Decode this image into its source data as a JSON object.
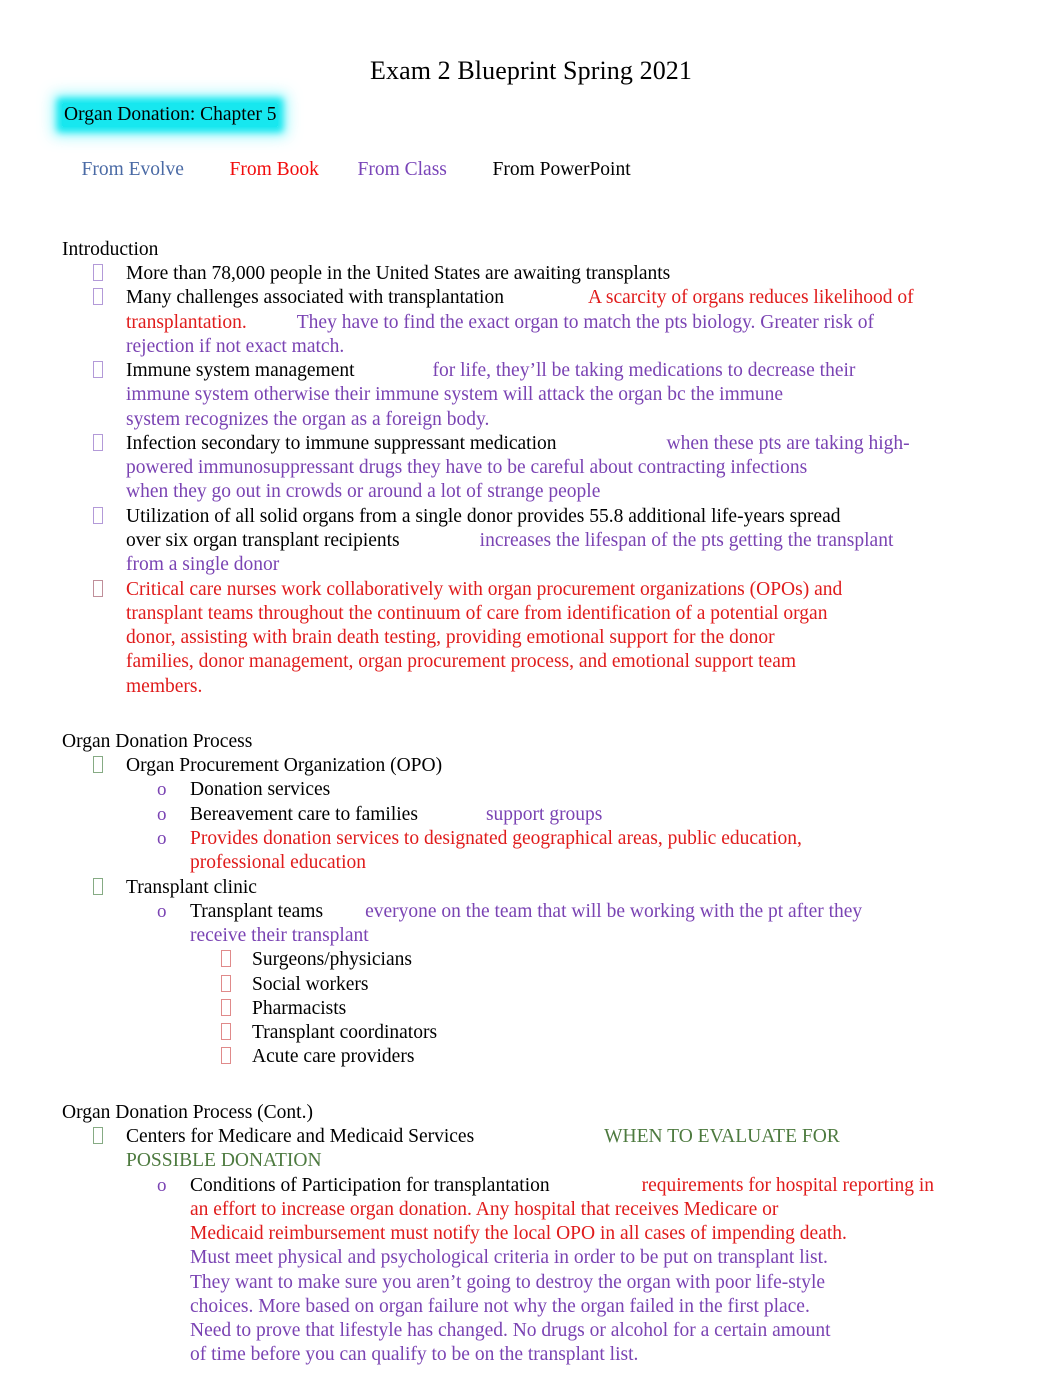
{
  "document": {
    "title": "Exam 2 Blueprint Spring 2021",
    "chapter_heading": "Organ Donation: Chapter 5",
    "highlight_color": "#17e7ef"
  },
  "legend": {
    "evolve": "From Evolve",
    "book": "From Book",
    "class": "From Class",
    "powerpoint": "From PowerPoint",
    "colors": {
      "evolve": "#4a6aa5",
      "book": "#f10c0c",
      "class": "#7944b8",
      "powerpoint": "#000000"
    }
  },
  "sections": {
    "introduction": {
      "heading": "Introduction",
      "b1": "More than 78,000 people in the United States are awaiting transplants",
      "b2_black": "Many challenges associated with transplantation",
      "b2_red_a": "A scarcity of organs reduces likelihood of",
      "b2_red_b": "transplantation.",
      "b2_purple_a": "They have to find the exact organ to match the pts biology. Greater risk of",
      "b2_purple_b": "rejection if not exact match.",
      "b3_black": "Immune system management",
      "b3_purple_a": "for life, they’ll be taking medications to decrease their",
      "b3_purple_b": "immune system otherwise their immune system will attack the organ bc the immune",
      "b3_purple_c": "system recognizes the organ as a foreign body.",
      "b4_black": "Infection secondary to immune suppressant medication",
      "b4_purple_a": "when these pts are taking high-",
      "b4_purple_b": "powered immunosuppressant drugs they have to be careful about contracting infections",
      "b4_purple_c": "when they go out in crowds or around a lot of strange people",
      "b5_black_a": "Utilization of all solid organs from a single donor provides 55.8 additional life-years spread",
      "b5_black_b": "over six organ transplant recipients",
      "b5_purple_a": "increases the lifespan of the pts getting the transplant",
      "b5_purple_b": "from a single donor",
      "b6_red_a": "Critical care nurses work collaboratively with organ procurement organizations (OPOs) and",
      "b6_red_b": "transplant teams throughout the continuum of care from identification of a potential organ",
      "b6_red_c": "donor, assisting with brain death testing, providing emotional support for the donor",
      "b6_red_d": "families, donor management, organ procurement process, and emotional support team",
      "b6_red_e": "members."
    },
    "process": {
      "heading": "Organ Donation Process",
      "opo": "Organ Procurement Organization (OPO)",
      "opo_sub1": "Donation services",
      "opo_sub2_black": "Bereavement care to families",
      "opo_sub2_purple": "support groups",
      "opo_sub3_red_a": "Provides donation services to designated geographical areas, public education,",
      "opo_sub3_red_b": "professional education",
      "clinic": "Transplant clinic",
      "clinic_sub_black": "Transplant teams",
      "clinic_sub_purple_a": "everyone on the team that will be working with the pt after they",
      "clinic_sub_purple_b": "receive their transplant",
      "team": [
        "Surgeons/physicians",
        "Social workers",
        "Pharmacists",
        "Transplant coordinators",
        "Acute care providers"
      ]
    },
    "process_cont": {
      "heading": "Organ Donation Process (Cont.)",
      "cms_black": "Centers for Medicare and Medicaid Services",
      "cms_green_a": "WHEN TO EVALUATE FOR",
      "cms_green_b": "POSSIBLE DONATION",
      "cop_black": "Conditions of Participation for transplantation",
      "cop_red_a": "requirements for hospital reporting in",
      "cop_red_b": "an effort to increase organ donation. Any hospital that receives Medicare or",
      "cop_red_c": "Medicaid reimbursement must notify the local OPO in all cases of impending death.",
      "cop_purple_a": "Must meet physical and psychological criteria in order to be put on transplant list.",
      "cop_purple_b": "They want to make sure you aren’t going to destroy the organ with poor life-style",
      "cop_purple_c": "choices. More based on organ failure not why the organ failed in the first place.",
      "cop_purple_d": "Need to prove that lifestyle has changed. No drugs or alcohol for a certain amount",
      "cop_purple_e": "of time before you can qualify to be on the transplant list."
    }
  }
}
